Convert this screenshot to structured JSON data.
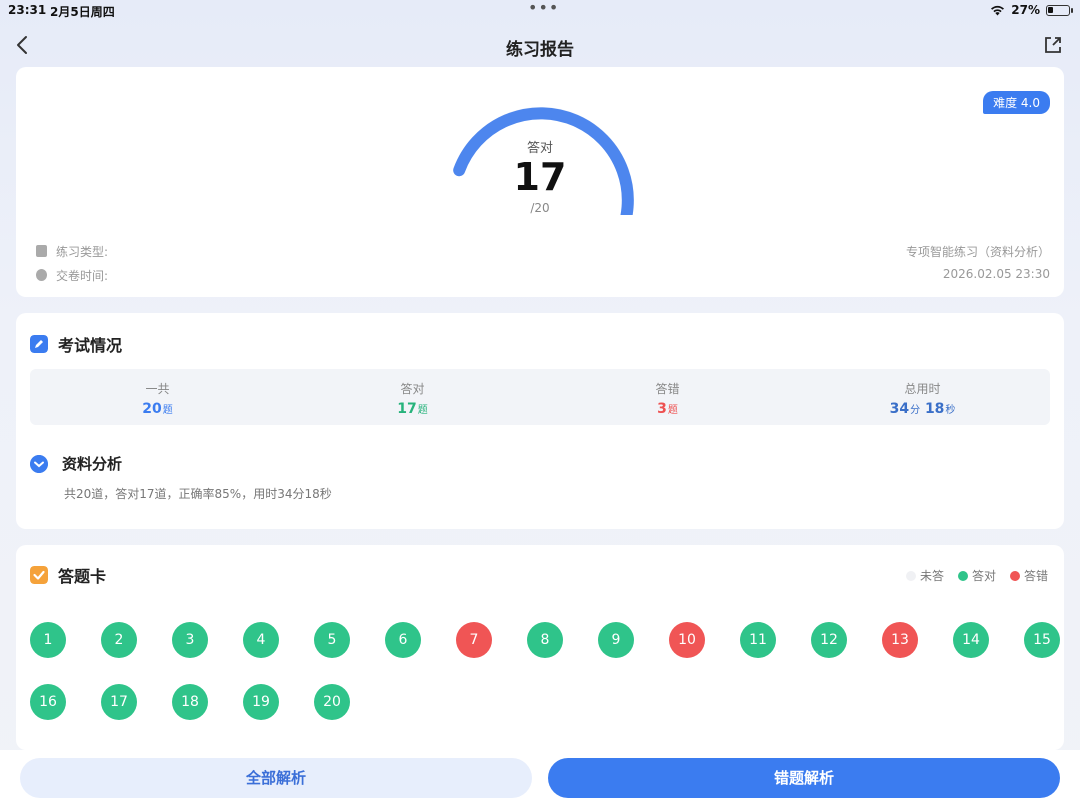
{
  "status": {
    "time": "23:31",
    "date": "2月5日周四",
    "battery": "27%",
    "battery_level": 0.27
  },
  "nav": {
    "title": "练习报告"
  },
  "score": {
    "difficulty": "难度 4.0",
    "label": "答对",
    "correct": "17",
    "total": "/20",
    "progress": 0.85,
    "practice_type_label": "练习类型:",
    "practice_type_value": "专项智能练习（资料分析）",
    "submit_time_label": "交卷时间:",
    "submit_time_value": "2026.02.05 23:30"
  },
  "exam": {
    "title": "考试情况",
    "stats": [
      {
        "label": "一共",
        "value": "20",
        "unit": "题"
      },
      {
        "label": "答对",
        "value": "17",
        "unit": "题"
      },
      {
        "label": "答错",
        "value": "3",
        "unit": "题"
      },
      {
        "label": "总用时",
        "min": "34",
        "min_unit": "分",
        "sec": "18",
        "sec_unit": "秒"
      }
    ],
    "subject_title": "资料分析",
    "subject_desc": "共20道，答对17道，正确率85%，用时34分18秒"
  },
  "answer_card": {
    "title": "答题卡",
    "legend": {
      "unanswered": "未答",
      "correct": "答对",
      "wrong": "答错"
    },
    "questions": [
      {
        "n": "1",
        "s": "correct"
      },
      {
        "n": "2",
        "s": "correct"
      },
      {
        "n": "3",
        "s": "correct"
      },
      {
        "n": "4",
        "s": "correct"
      },
      {
        "n": "5",
        "s": "correct"
      },
      {
        "n": "6",
        "s": "correct"
      },
      {
        "n": "7",
        "s": "wrong"
      },
      {
        "n": "8",
        "s": "correct"
      },
      {
        "n": "9",
        "s": "correct"
      },
      {
        "n": "10",
        "s": "wrong"
      },
      {
        "n": "11",
        "s": "correct"
      },
      {
        "n": "12",
        "s": "correct"
      },
      {
        "n": "13",
        "s": "wrong"
      },
      {
        "n": "14",
        "s": "correct"
      },
      {
        "n": "15",
        "s": "correct"
      },
      {
        "n": "16",
        "s": "correct"
      },
      {
        "n": "17",
        "s": "correct"
      },
      {
        "n": "18",
        "s": "correct"
      },
      {
        "n": "19",
        "s": "correct"
      },
      {
        "n": "20",
        "s": "correct"
      }
    ]
  },
  "buttons": {
    "all": "全部解析",
    "wrong": "错题解析"
  },
  "colors": {
    "accent": "#3b7cf0",
    "correct": "#2fc48a",
    "wrong": "#f05555"
  }
}
